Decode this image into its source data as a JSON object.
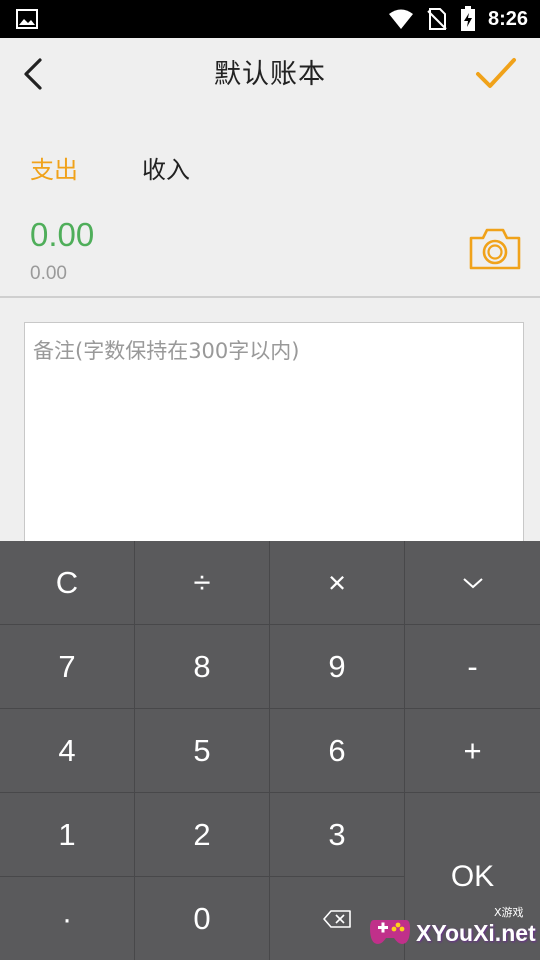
{
  "status_bar": {
    "time": "8:26",
    "icons": [
      "image-icon",
      "wifi-icon",
      "no-sim-icon",
      "battery-charging-icon"
    ]
  },
  "header": {
    "title": "默认账本",
    "back_icon": "chevron-left-icon",
    "confirm_icon": "checkmark-icon"
  },
  "tabs": {
    "expense": "支出",
    "income": "收入",
    "active": "expense"
  },
  "amount": {
    "value": "0.00",
    "sub_value": "0.00"
  },
  "note": {
    "placeholder": "备注(字数保持在300字以内)",
    "value": ""
  },
  "keypad": {
    "rows": [
      [
        "C",
        "÷",
        "×",
        "﹀"
      ],
      [
        "7",
        "8",
        "9",
        "-"
      ],
      [
        "4",
        "5",
        "6",
        "+"
      ],
      [
        "1",
        "2",
        "3",
        "OK"
      ],
      [
        "·",
        "0",
        "⌫"
      ]
    ]
  },
  "watermark": {
    "text": "XYouXi.net",
    "small": "X游戏"
  },
  "colors": {
    "accent": "#f0a21a",
    "amount": "#4fae5a",
    "keypad_bg": "#5a5a5c"
  }
}
